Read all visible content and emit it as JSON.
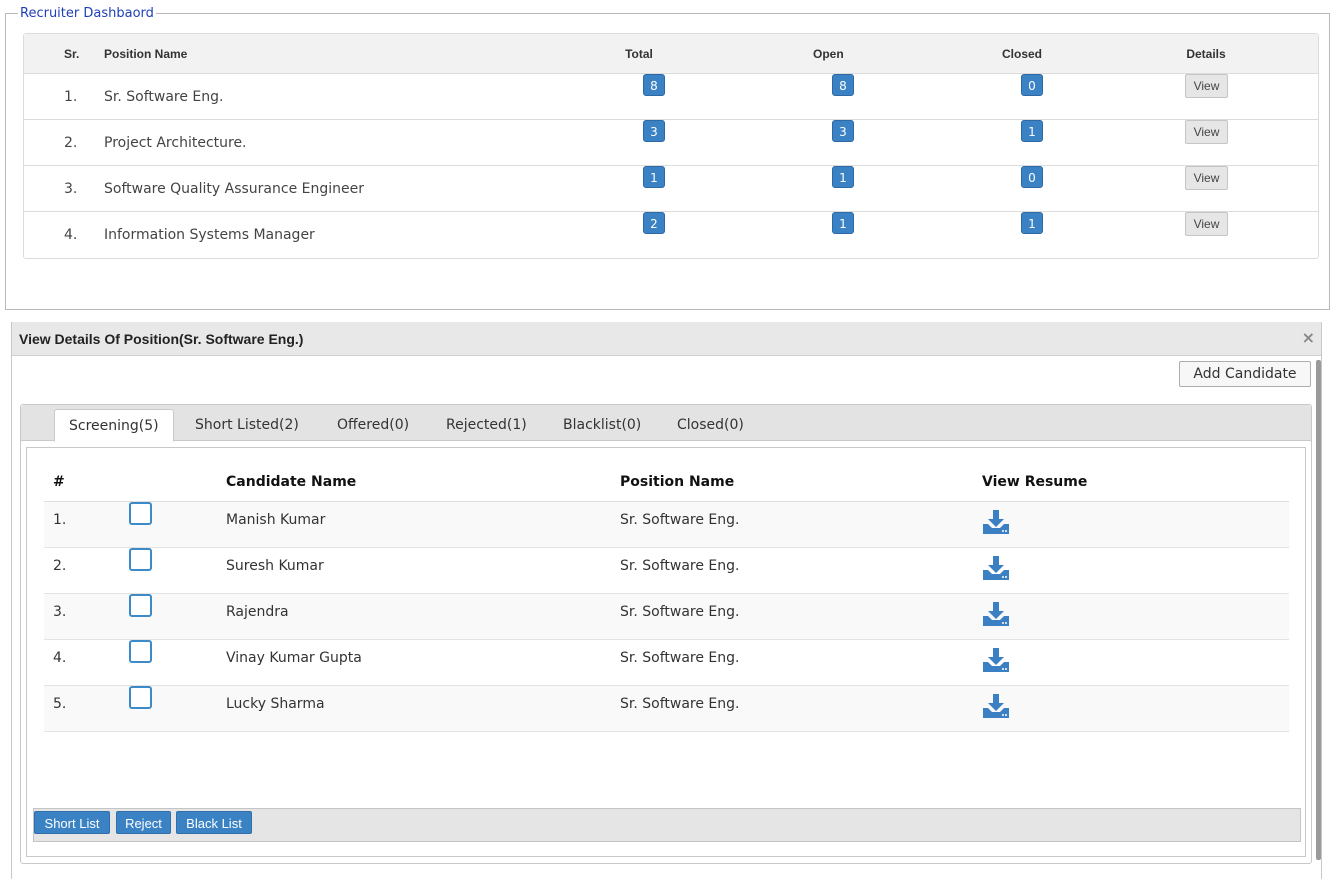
{
  "dashboard": {
    "legend": "Recruiter Dashbaord",
    "headers": {
      "sr": "Sr.",
      "position": "Position Name",
      "total": "Total",
      "open": "Open",
      "closed": "Closed",
      "details": "Details"
    },
    "view_label": "View",
    "rows": [
      {
        "sr": "1.",
        "name": "Sr. Software Eng.",
        "total": "8",
        "open": "8",
        "closed": "0"
      },
      {
        "sr": "2.",
        "name": "Project Architecture.",
        "total": "3",
        "open": "3",
        "closed": "1"
      },
      {
        "sr": "3.",
        "name": "Software Quality Assurance Engineer",
        "total": "1",
        "open": "1",
        "closed": "0"
      },
      {
        "sr": "4.",
        "name": "Information Systems Manager",
        "total": "2",
        "open": "1",
        "closed": "1"
      }
    ]
  },
  "dialog": {
    "title": "View Details Of Position(Sr. Software Eng.)",
    "close_glyph": "×",
    "add_candidate_label": "Add Candidate",
    "tabs": [
      {
        "label": "Screening(5)",
        "active": true
      },
      {
        "label": "Short Listed(2)",
        "active": false
      },
      {
        "label": "Offered(0)",
        "active": false
      },
      {
        "label": "Rejected(1)",
        "active": false
      },
      {
        "label": "Blacklist(0)",
        "active": false
      },
      {
        "label": "Closed(0)",
        "active": false
      }
    ],
    "table_headers": {
      "num": "#",
      "candidate": "Candidate Name",
      "position": "Position Name",
      "resume": "View Resume"
    },
    "candidates": [
      {
        "num": "1.",
        "name": "Manish Kumar",
        "position": "Sr. Software Eng.",
        "checked": false
      },
      {
        "num": "2.",
        "name": "Suresh Kumar",
        "position": "Sr. Software Eng.",
        "checked": false
      },
      {
        "num": "3.",
        "name": "Rajendra",
        "position": "Sr. Software Eng.",
        "checked": false
      },
      {
        "num": "4.",
        "name": "Vinay Kumar Gupta",
        "position": "Sr. Software Eng.",
        "checked": false
      },
      {
        "num": "5.",
        "name": "Lucky Sharma",
        "position": "Sr. Software Eng.",
        "checked": false
      }
    ],
    "resume_icon": "download-icon",
    "actions": {
      "short_list": "Short List",
      "reject": "Reject",
      "black_list": "Black List"
    }
  },
  "colors": {
    "accent": "#3b82c4",
    "legend": "#1f3fb8"
  }
}
